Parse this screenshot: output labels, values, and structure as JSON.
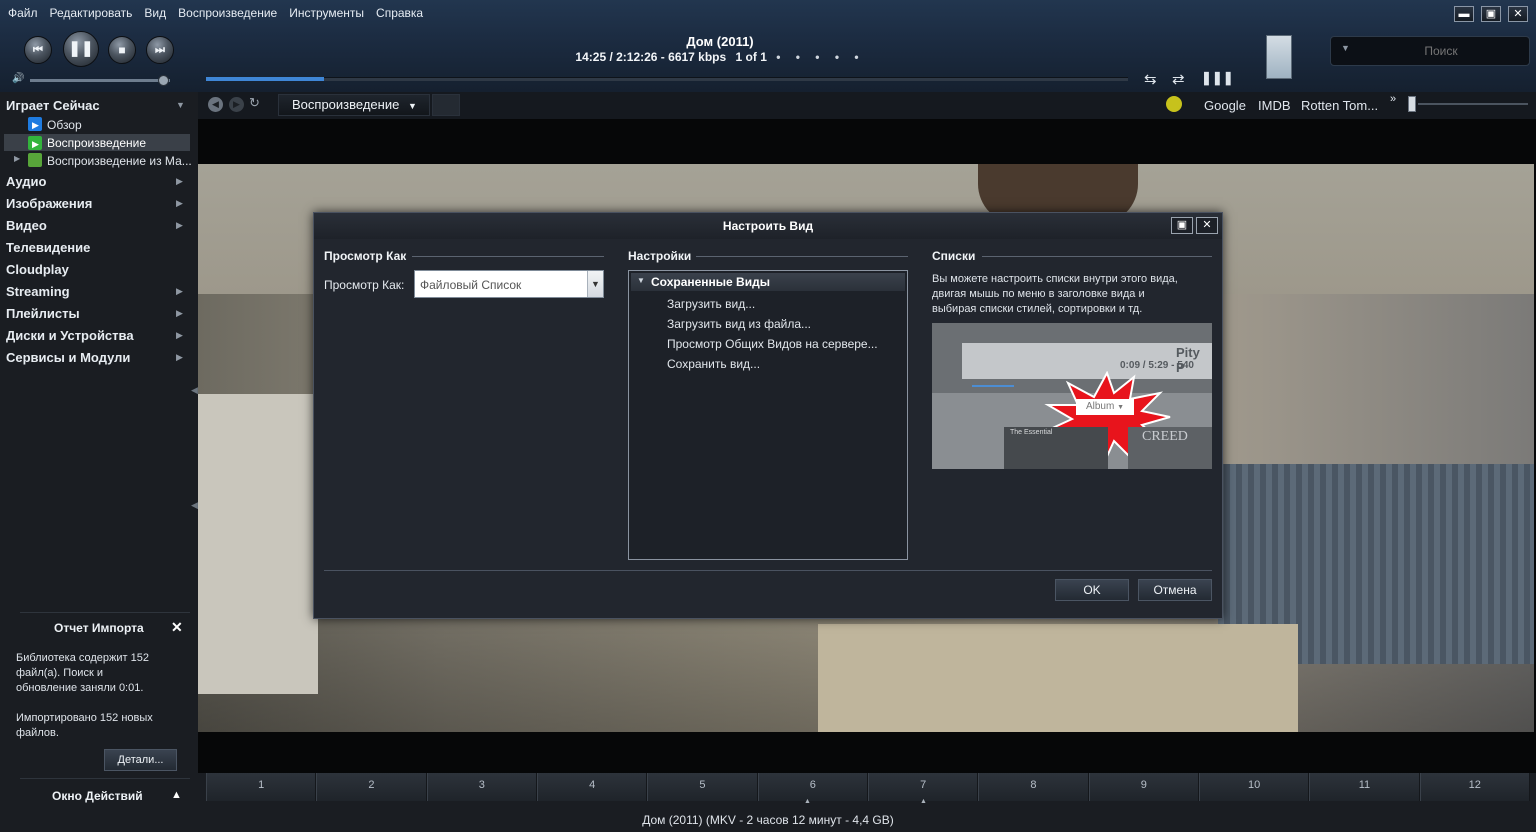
{
  "menu": [
    "Файл",
    "Редактировать",
    "Вид",
    "Воспроизведение",
    "Инструменты",
    "Справка"
  ],
  "now_playing": {
    "title": "Дом (2011)",
    "info": "14:25 / 2:12:26 - 6617 kbps",
    "track": "1 of 1",
    "dots": "• • • • •",
    "progress": 0.128,
    "volume": 0.95
  },
  "search": {
    "placeholder": "Поиск"
  },
  "navbar": {
    "view_label": "Воспроизведение",
    "links": [
      "Google",
      "IMDB",
      "Rotten Tom..."
    ],
    "more": "»"
  },
  "sidebar": {
    "playing_now": "Играет Сейчас",
    "sub_items": [
      "Обзор",
      "Воспроизведение",
      "Воспроизведение из Ма..."
    ],
    "categories": [
      "Аудио",
      "Изображения",
      "Видео",
      "Телевидение",
      "Cloudplay",
      "Streaming",
      "Плейлисты",
      "Диски и Устройства",
      "Сервисы и Модули"
    ],
    "import_report": {
      "title": "Отчет Импорта",
      "line1": "Библиотека содержит 152",
      "line2": "файл(а). Поиск и",
      "line3": "обновление заняли 0:01.",
      "line4": "Импортировано 152 новых",
      "line5": "файлов.",
      "details_button": "Детали..."
    },
    "actions_window": "Окно Действий"
  },
  "dialog": {
    "title": "Настроить Вид",
    "view_as": {
      "heading": "Просмотр Как",
      "label": "Просмотр Как:",
      "value": "Файловый Список"
    },
    "settings": {
      "heading": "Настройки",
      "group": "Сохраненные Виды",
      "items": [
        "Загрузить вид...",
        "Загрузить вид из файла...",
        "Просмотр Общих Видов на сервере...",
        "Сохранить вид..."
      ]
    },
    "lists": {
      "heading": "Списки",
      "line1": "Вы можете настроить списки внутри этого вида,",
      "line2": "двигая мышь по меню в заголовке вида и",
      "line3": "выбирая списки стилей, сортировки и тд.",
      "preview": {
        "title": "Pity P",
        "time": "0:09 / 5:29 - 540",
        "album": "Album",
        "creed": "CREED",
        "cover": "The Essential"
      }
    },
    "ok": "OK",
    "cancel": "Отмена"
  },
  "chapters": [
    "1",
    "2",
    "3",
    "4",
    "5",
    "6",
    "7",
    "8",
    "9",
    "10",
    "11",
    "12"
  ],
  "status": "Дом (2011) (MKV - 2 часов 12 минут - 4,4 GB)",
  "colors": {
    "accent": "#3f86d6",
    "now_playing_icon": "#1e7be0",
    "playback_icon": "#33b43c",
    "status_dot": "#c7c21c"
  }
}
